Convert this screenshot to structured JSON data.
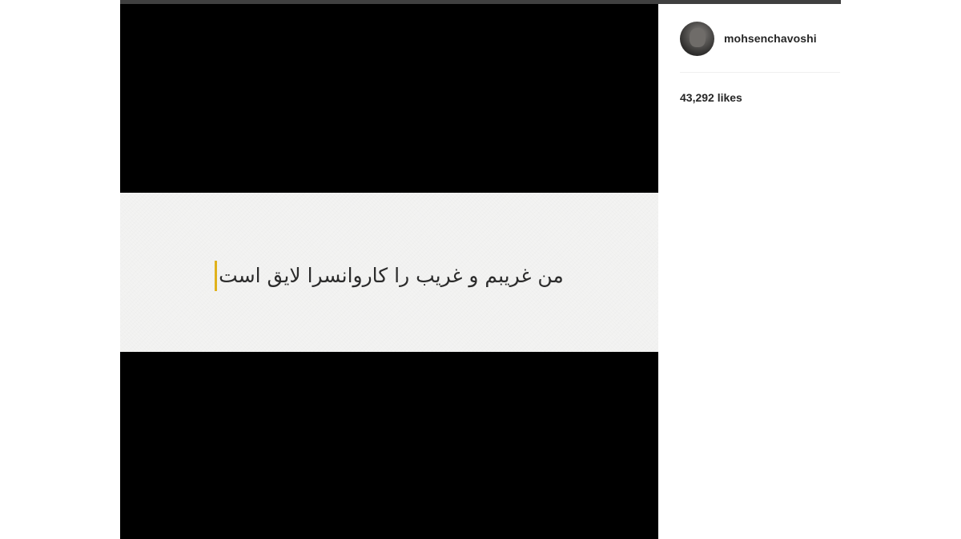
{
  "post": {
    "caption_text": "من غریبم و غریب را کاروانسرا لایق است",
    "cursor_color": "#e0b21c"
  },
  "author": {
    "username": "mohsenchavoshi",
    "avatar_icon": "user-avatar-photo"
  },
  "stats": {
    "likes_label": "43,292 likes"
  }
}
